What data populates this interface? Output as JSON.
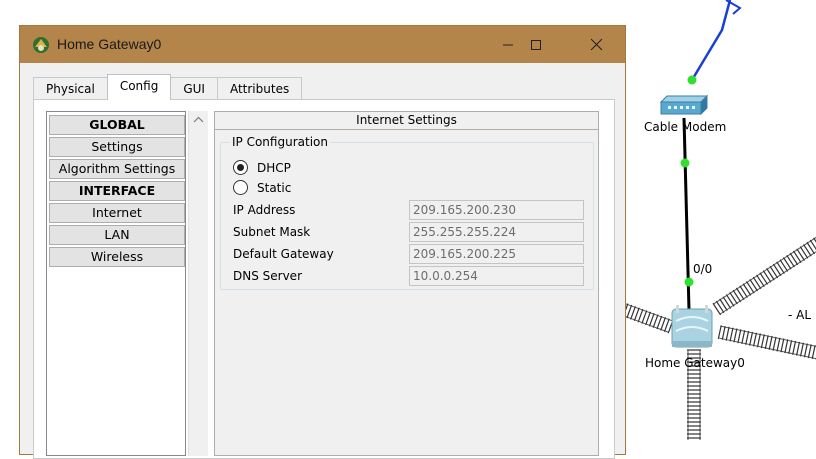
{
  "window": {
    "title": "Home Gateway0",
    "controls": {
      "minimize": "minimize",
      "maximize": "maximize",
      "close": "close"
    }
  },
  "tabs": [
    {
      "label": "Physical",
      "active": false
    },
    {
      "label": "Config",
      "active": true
    },
    {
      "label": "GUI",
      "active": false
    },
    {
      "label": "Attributes",
      "active": false
    }
  ],
  "sidebar": {
    "items": [
      {
        "label": "GLOBAL",
        "header": true
      },
      {
        "label": "Settings",
        "header": false
      },
      {
        "label": "Algorithm Settings",
        "header": false
      },
      {
        "label": "INTERFACE",
        "header": true
      },
      {
        "label": "Internet",
        "header": false
      },
      {
        "label": "LAN",
        "header": false
      },
      {
        "label": "Wireless",
        "header": false
      }
    ]
  },
  "settings": {
    "title": "Internet Settings",
    "ip_config_legend": "IP Configuration",
    "mode_options": [
      {
        "label": "DHCP",
        "checked": true
      },
      {
        "label": "Static",
        "checked": false
      }
    ],
    "fields": [
      {
        "label": "IP Address",
        "value": "209.165.200.230"
      },
      {
        "label": "Subnet Mask",
        "value": "255.255.255.224"
      },
      {
        "label": "Default Gateway",
        "value": "209.165.200.225"
      },
      {
        "label": "DNS Server",
        "value": "10.0.0.254"
      }
    ]
  },
  "topology": {
    "cable_modem_label": "Cable Modem",
    "gateway_label": "Home Gateway0",
    "port_label": "0/0",
    "partial_label": "-  AL",
    "link_colors": {
      "wan": "#1a3fd6",
      "copper": "#000000",
      "port_dot": "#2fe02f"
    }
  }
}
